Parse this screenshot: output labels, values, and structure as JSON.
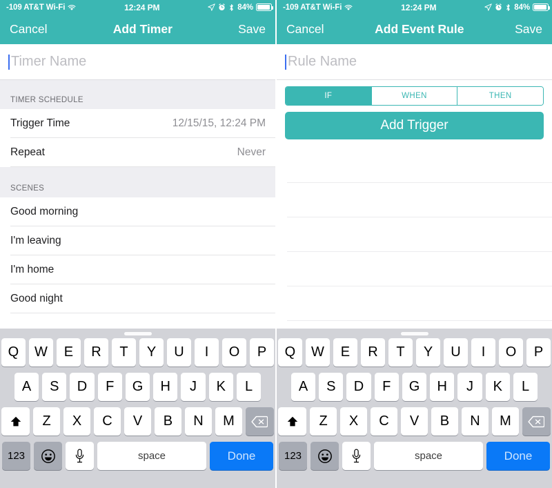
{
  "status_bar": {
    "carrier": "-109 AT&T Wi-Fi",
    "wifi_icon": "wifi-icon",
    "time": "12:24 PM",
    "location_icon": "location-arrow-icon",
    "alarm_icon": "alarm-clock-icon",
    "bluetooth_icon": "bluetooth-icon",
    "battery_percent": "84%",
    "battery_level": 84
  },
  "colors": {
    "accent_teal": "#3bb7b3",
    "done_blue": "#0a79f7",
    "caret_blue": "#3b6ef0",
    "section_header_bg": "#eeeef2",
    "keyboard_bg": "#d2d3d8"
  },
  "left_screen": {
    "nav": {
      "cancel_label": "Cancel",
      "title": "Add Timer",
      "save_label": "Save"
    },
    "name_field": {
      "value": "",
      "placeholder": "Timer Name"
    },
    "schedule_section": {
      "header": "TIMER SCHEDULE",
      "rows": [
        {
          "title": "Trigger Time",
          "value": "12/15/15, 12:24 PM"
        },
        {
          "title": "Repeat",
          "value": "Never"
        }
      ]
    },
    "scenes_section": {
      "header": "SCENES",
      "rows": [
        {
          "title": "Good morning",
          "value": ""
        },
        {
          "title": "I'm leaving",
          "value": ""
        },
        {
          "title": "I'm home",
          "value": ""
        },
        {
          "title": "Good night",
          "value": ""
        }
      ]
    }
  },
  "right_screen": {
    "nav": {
      "cancel_label": "Cancel",
      "title": "Add Event Rule",
      "save_label": "Save"
    },
    "name_field": {
      "value": "",
      "placeholder": "Rule Name"
    },
    "segmented": {
      "options": [
        "IF",
        "WHEN",
        "THEN"
      ],
      "selected_index": 0
    },
    "add_trigger_label": "Add Trigger",
    "empty_rows_count": 5
  },
  "keyboard": {
    "handle": "keyboard-drag-handle",
    "row1": [
      "Q",
      "W",
      "E",
      "R",
      "T",
      "Y",
      "U",
      "I",
      "O",
      "P"
    ],
    "row2": [
      "A",
      "S",
      "D",
      "F",
      "G",
      "H",
      "J",
      "K",
      "L"
    ],
    "row3": [
      "Z",
      "X",
      "C",
      "V",
      "B",
      "N",
      "M"
    ],
    "shift_icon": "shift-up-arrow-icon",
    "backspace_icon": "backspace-delete-icon",
    "numbers_label": "123",
    "emoji_icon": "smiley-face-icon",
    "mic_icon": "microphone-icon",
    "space_label": "space",
    "done_label": "Done"
  }
}
